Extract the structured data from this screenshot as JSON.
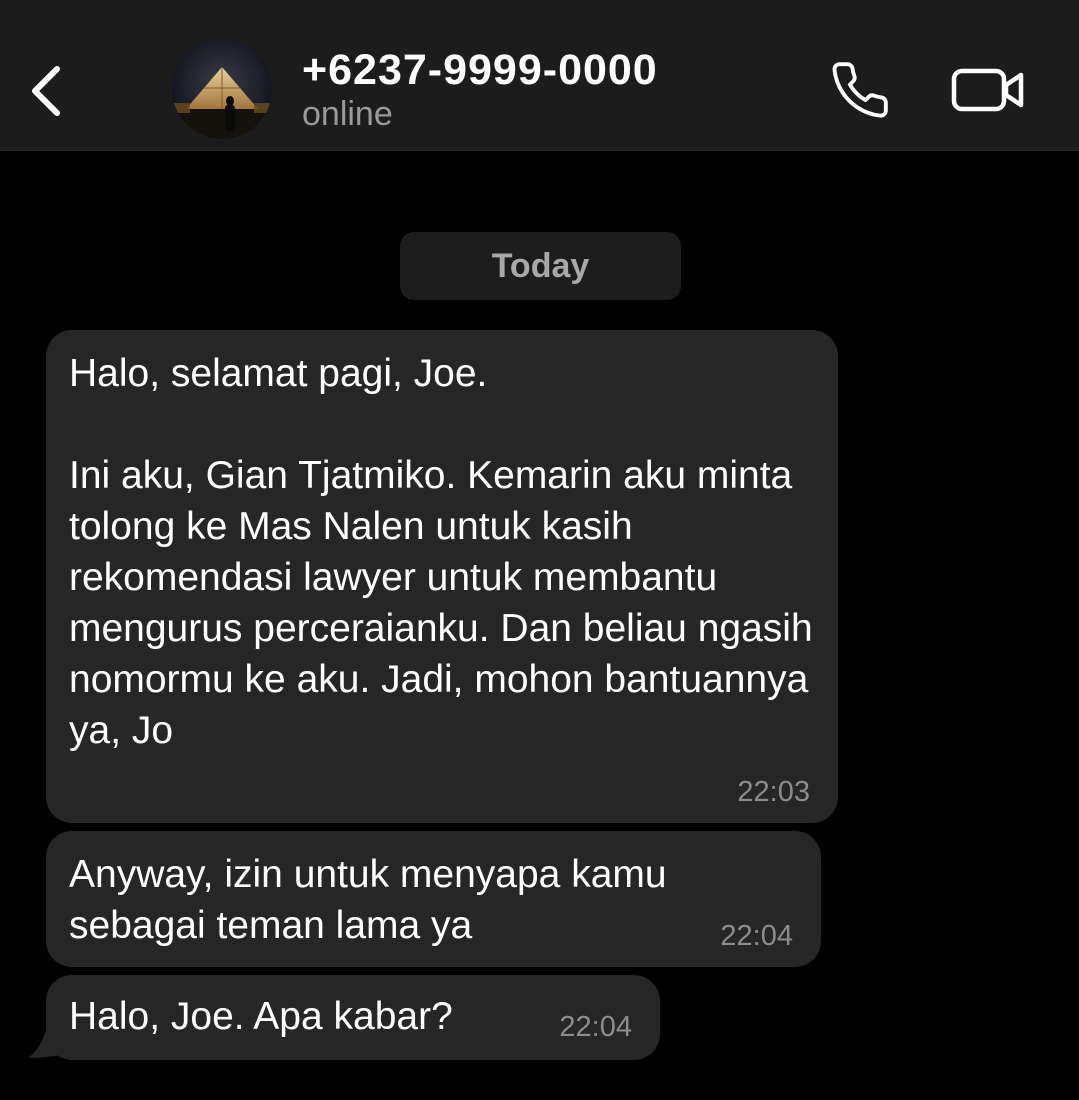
{
  "header": {
    "back_icon": "chevron-left-icon",
    "contact_name": "+6237-9999-0000",
    "status": "online",
    "avatar_icon": "avatar-photo",
    "call_icon": "phone-icon",
    "video_icon": "video-camera-icon"
  },
  "chat": {
    "date_label": "Today",
    "messages": [
      {
        "text": "Halo, selamat pagi, Joe.\n\nIni aku, Gian Tjatmiko. Kemarin aku minta tolong ke Mas Nalen untuk kasih rekomendasi lawyer untuk membantu mengurus perceraianku. Dan beliau ngasih nomormu ke aku. Jadi, mohon bantuannya ya, Jo",
        "time": "22:03"
      },
      {
        "text": "Anyway, izin untuk menyapa kamu sebagai teman lama ya",
        "time": "22:04"
      },
      {
        "text": "Halo, Joe. Apa kabar?",
        "time": "22:04"
      }
    ]
  },
  "colors": {
    "background": "#000000",
    "header": "#1c1c1c",
    "bubble": "#262626",
    "muted_text": "#9a9a9a"
  }
}
